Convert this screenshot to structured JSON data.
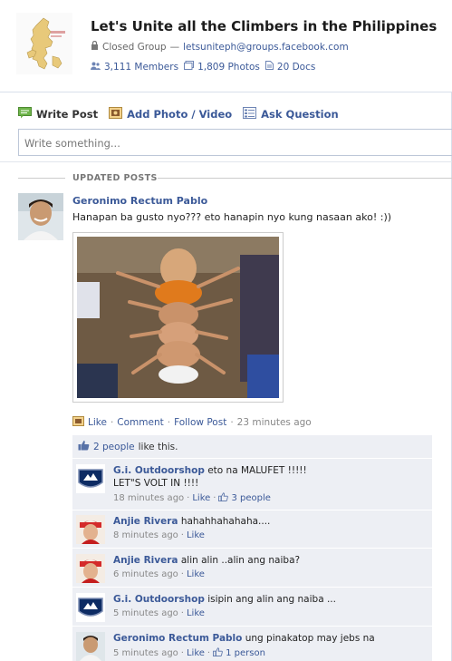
{
  "group": {
    "title": "Let's Unite all the Climbers in the Philippines",
    "privacy": "Closed Group",
    "email_sep": "—",
    "email": "letsuniteph@groups.facebook.com",
    "members": "3,111 Members",
    "photos": "1,809 Photos",
    "docs": "20 Docs"
  },
  "composer": {
    "tabs": [
      "Write Post",
      "Add Photo / Video",
      "Ask Question"
    ],
    "placeholder": "Write something..."
  },
  "section_label": "UPDATED POSTS",
  "post": {
    "author": "Geronimo Rectum Pablo",
    "text": "Hanapan ba gusto nyo??? eto hanapin nyo kung nasaan ako! :))",
    "actions": {
      "like": "Like",
      "comment": "Comment",
      "follow": "Follow Post",
      "time": "23 minutes ago",
      "sep": "·"
    },
    "likes": {
      "count": "2 people",
      "suffix": "like this."
    },
    "comments": [
      {
        "author": "G.i. Outdoorshop",
        "line1": "eto na MALUFET !!!!!",
        "line2": "LET\"S VOLT IN !!!!",
        "time": "18 minutes ago",
        "like": "Like",
        "likes": "3 people"
      },
      {
        "author": "Anjie Rivera",
        "line1": "hahahhahahaha....",
        "time": "8 minutes ago",
        "like": "Like"
      },
      {
        "author": "Anjie Rivera",
        "line1": "alin alin ..alin ang naiba?",
        "time": "6 minutes ago",
        "like": "Like"
      },
      {
        "author": "G.i. Outdoorshop",
        "line1": "isipin ang alin ang naiba ...",
        "time": "5 minutes ago",
        "like": "Like"
      },
      {
        "author": "Geronimo Rectum Pablo",
        "line1": "ung pinakatop may jebs na",
        "time": "5 minutes ago",
        "like": "Like",
        "likes": "1 person"
      }
    ]
  },
  "colors": {
    "link": "#3b5998",
    "comment_bg": "#edeff4",
    "muted": "#888888"
  },
  "icons": [
    "lock-icon",
    "members-icon",
    "photos-icon",
    "docs-icon",
    "write-post-icon",
    "add-photo-icon",
    "ask-question-icon",
    "thumbs-up-icon"
  ]
}
